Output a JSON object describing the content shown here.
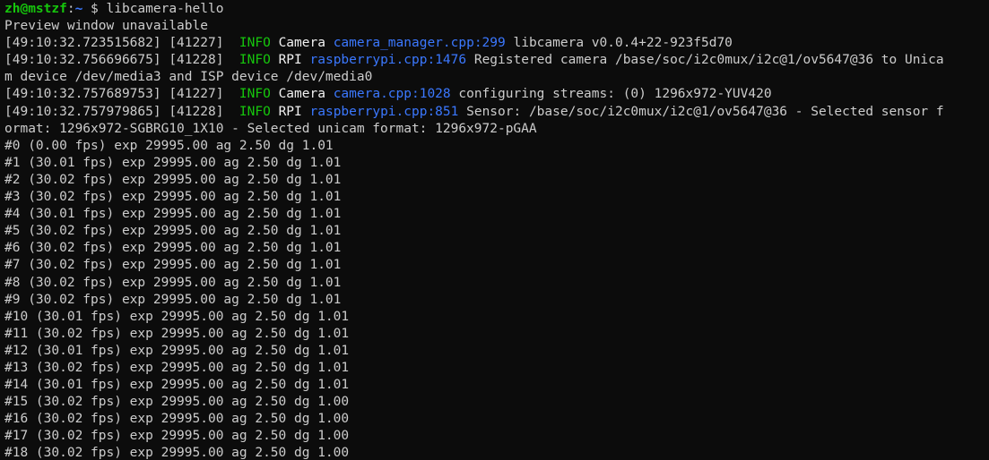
{
  "colors": {
    "background": "#0c0c0c",
    "foreground": "#cccccc",
    "info_green": "#16c60c",
    "link_blue": "#3b78ff",
    "category_white": "#f2f2f2"
  },
  "prompt": {
    "user_host": "zh@mstzf",
    "sep": ":",
    "path": "~",
    "dollar": " $ ",
    "command": "libcamera-hello"
  },
  "output": [
    [
      {
        "t": "Preview window unavailable",
        "c": "fg"
      }
    ],
    [
      {
        "t": "[49:10:32.723515682] [41227]  ",
        "c": "fg"
      },
      {
        "t": "INFO",
        "c": "info"
      },
      {
        "t": " ",
        "c": "fg"
      },
      {
        "t": "Camera",
        "c": "cat"
      },
      {
        "t": " ",
        "c": "fg"
      },
      {
        "t": "camera_manager.cpp:299",
        "c": "src"
      },
      {
        "t": " libcamera v0.0.4+22-923f5d70",
        "c": "fg"
      }
    ],
    [
      {
        "t": "[49:10:32.756696675] [41228]  ",
        "c": "fg"
      },
      {
        "t": "INFO",
        "c": "info"
      },
      {
        "t": " ",
        "c": "fg"
      },
      {
        "t": "RPI",
        "c": "cat"
      },
      {
        "t": " ",
        "c": "fg"
      },
      {
        "t": "raspberrypi.cpp:1476",
        "c": "src"
      },
      {
        "t": " Registered camera /base/soc/i2c0mux/i2c@1/ov5647@36 to Unica",
        "c": "fg"
      }
    ],
    [
      {
        "t": "m device /dev/media3 and ISP device /dev/media0",
        "c": "fg"
      }
    ],
    [
      {
        "t": "[49:10:32.757689753] [41227]  ",
        "c": "fg"
      },
      {
        "t": "INFO",
        "c": "info"
      },
      {
        "t": " ",
        "c": "fg"
      },
      {
        "t": "Camera",
        "c": "cat"
      },
      {
        "t": " ",
        "c": "fg"
      },
      {
        "t": "camera.cpp:1028",
        "c": "src"
      },
      {
        "t": " configuring streams: (0) 1296x972-YUV420",
        "c": "fg"
      }
    ],
    [
      {
        "t": "[49:10:32.757979865] [41228]  ",
        "c": "fg"
      },
      {
        "t": "INFO",
        "c": "info"
      },
      {
        "t": " ",
        "c": "fg"
      },
      {
        "t": "RPI",
        "c": "cat"
      },
      {
        "t": " ",
        "c": "fg"
      },
      {
        "t": "raspberrypi.cpp:851",
        "c": "src"
      },
      {
        "t": " Sensor: /base/soc/i2c0mux/i2c@1/ov5647@36 - Selected sensor f",
        "c": "fg"
      }
    ],
    [
      {
        "t": "ormat: 1296x972-SGBRG10_1X10 - Selected unicam format: 1296x972-pGAA",
        "c": "fg"
      }
    ],
    [
      {
        "t": "#0 (0.00 fps) exp 29995.00 ag 2.50 dg 1.01",
        "c": "fg"
      }
    ],
    [
      {
        "t": "#1 (30.01 fps) exp 29995.00 ag 2.50 dg 1.01",
        "c": "fg"
      }
    ],
    [
      {
        "t": "#2 (30.02 fps) exp 29995.00 ag 2.50 dg 1.01",
        "c": "fg"
      }
    ],
    [
      {
        "t": "#3 (30.02 fps) exp 29995.00 ag 2.50 dg 1.01",
        "c": "fg"
      }
    ],
    [
      {
        "t": "#4 (30.01 fps) exp 29995.00 ag 2.50 dg 1.01",
        "c": "fg"
      }
    ],
    [
      {
        "t": "#5 (30.02 fps) exp 29995.00 ag 2.50 dg 1.01",
        "c": "fg"
      }
    ],
    [
      {
        "t": "#6 (30.02 fps) exp 29995.00 ag 2.50 dg 1.01",
        "c": "fg"
      }
    ],
    [
      {
        "t": "#7 (30.02 fps) exp 29995.00 ag 2.50 dg 1.01",
        "c": "fg"
      }
    ],
    [
      {
        "t": "#8 (30.02 fps) exp 29995.00 ag 2.50 dg 1.01",
        "c": "fg"
      }
    ],
    [
      {
        "t": "#9 (30.02 fps) exp 29995.00 ag 2.50 dg 1.01",
        "c": "fg"
      }
    ],
    [
      {
        "t": "#10 (30.01 fps) exp 29995.00 ag 2.50 dg 1.01",
        "c": "fg"
      }
    ],
    [
      {
        "t": "#11 (30.02 fps) exp 29995.00 ag 2.50 dg 1.01",
        "c": "fg"
      }
    ],
    [
      {
        "t": "#12 (30.01 fps) exp 29995.00 ag 2.50 dg 1.01",
        "c": "fg"
      }
    ],
    [
      {
        "t": "#13 (30.02 fps) exp 29995.00 ag 2.50 dg 1.01",
        "c": "fg"
      }
    ],
    [
      {
        "t": "#14 (30.01 fps) exp 29995.00 ag 2.50 dg 1.01",
        "c": "fg"
      }
    ],
    [
      {
        "t": "#15 (30.02 fps) exp 29995.00 ag 2.50 dg 1.00",
        "c": "fg"
      }
    ],
    [
      {
        "t": "#16 (30.02 fps) exp 29995.00 ag 2.50 dg 1.00",
        "c": "fg"
      }
    ],
    [
      {
        "t": "#17 (30.02 fps) exp 29995.00 ag 2.50 dg 1.00",
        "c": "fg"
      }
    ],
    [
      {
        "t": "#18 (30.02 fps) exp 29995.00 ag 2.50 dg 1.00",
        "c": "fg"
      }
    ]
  ]
}
